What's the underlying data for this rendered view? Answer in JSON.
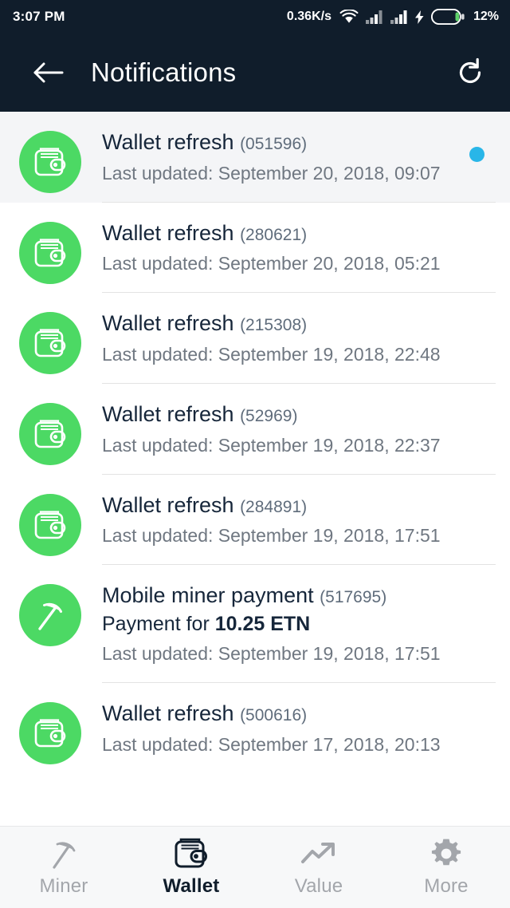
{
  "status_bar": {
    "clock": "3:07 PM",
    "network_speed": "0.36K/s",
    "battery_percent": "12%",
    "icons": [
      "wifi-icon",
      "signal-icon",
      "signal-icon",
      "charging-bolt-icon",
      "battery-icon"
    ],
    "background_color": "#101d2b"
  },
  "app_bar": {
    "title": "Notifications",
    "back_icon": "back-arrow-icon",
    "refresh_icon": "refresh-icon",
    "background_color": "#101d2b"
  },
  "colors": {
    "accent_green": "#4cd964",
    "unread_dot": "#29b6e8",
    "unread_row_bg": "#f4f5f7",
    "dark_navy": "#101d2b"
  },
  "notifications": [
    {
      "icon": "wallet-icon",
      "title": "Wallet refresh",
      "id": "(051596)",
      "detail": null,
      "time": "Last updated: September 20, 2018, 09:07",
      "unread": true
    },
    {
      "icon": "wallet-icon",
      "title": "Wallet refresh",
      "id": "(280621)",
      "detail": null,
      "time": "Last updated: September 20, 2018, 05:21",
      "unread": false
    },
    {
      "icon": "wallet-icon",
      "title": "Wallet refresh",
      "id": "(215308)",
      "detail": null,
      "time": "Last updated: September 19, 2018, 22:48",
      "unread": false
    },
    {
      "icon": "wallet-icon",
      "title": "Wallet refresh",
      "id": "(52969)",
      "detail": null,
      "time": "Last updated: September 19, 2018, 22:37",
      "unread": false
    },
    {
      "icon": "wallet-icon",
      "title": "Wallet refresh",
      "id": "(284891)",
      "detail": null,
      "time": "Last updated: September 19, 2018, 17:51",
      "unread": false
    },
    {
      "icon": "pickaxe-icon",
      "title": "Mobile miner payment",
      "id": "(517695)",
      "detail_prefix": "Payment for ",
      "detail_amount": "10.25 ETN",
      "time": "Last updated: September 19, 2018, 17:51",
      "unread": false
    },
    {
      "icon": "wallet-icon",
      "title": "Wallet refresh",
      "id": "(500616)",
      "detail": null,
      "time": "Last updated: September 17, 2018, 20:13",
      "unread": false
    }
  ],
  "bottom_nav": {
    "items": [
      {
        "label": "Miner",
        "icon": "pickaxe-icon",
        "active": false
      },
      {
        "label": "Wallet",
        "icon": "wallet-icon",
        "active": true
      },
      {
        "label": "Value",
        "icon": "trending-up-icon",
        "active": false
      },
      {
        "label": "More",
        "icon": "gear-icon",
        "active": false
      }
    ]
  }
}
